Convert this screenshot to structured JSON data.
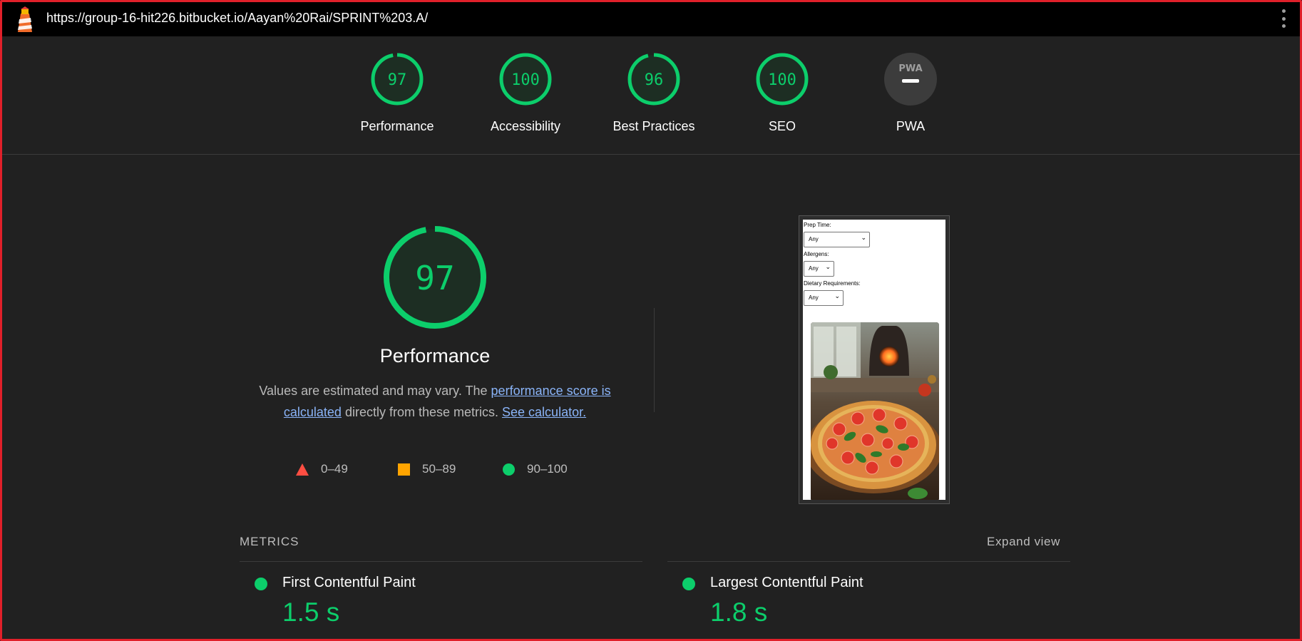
{
  "browser": {
    "url": "https://group-16-hit226.bitbucket.io/Aayan%20Rai/SPRINT%203.A/",
    "menu_icon": "kebab-menu-icon",
    "logo_icon": "lighthouse-icon"
  },
  "gauges": [
    {
      "score": "97",
      "label": "Performance",
      "color": "#0cce6b"
    },
    {
      "score": "100",
      "label": "Accessibility",
      "color": "#0cce6b"
    },
    {
      "score": "96",
      "label": "Best Practices",
      "color": "#0cce6b"
    },
    {
      "score": "100",
      "label": "SEO",
      "color": "#0cce6b"
    },
    {
      "score": "PWA",
      "label": "PWA",
      "color": "#9e9e9e"
    }
  ],
  "performance": {
    "score": "97",
    "title": "Performance",
    "desc_prefix": "Values are estimated and may vary. The ",
    "link1": "performance score is calculated",
    "desc_middle": " directly from these metrics. ",
    "link2": "See calculator.",
    "legend": [
      {
        "range": "0–49",
        "color": "#ff4e42"
      },
      {
        "range": "50–89",
        "color": "#ffa400"
      },
      {
        "range": "90–100",
        "color": "#0cce6b"
      }
    ]
  },
  "preview": {
    "fields": [
      {
        "label": "Prep Time:",
        "value": "Any"
      },
      {
        "label": "Allergens:",
        "value": "Any"
      },
      {
        "label": "Dietary Requirements:",
        "value": "Any"
      }
    ]
  },
  "metrics": {
    "title": "METRICS",
    "expand_label": "Expand view",
    "items": [
      {
        "name": "First Contentful Paint",
        "value": "1.5 s"
      },
      {
        "name": "Largest Contentful Paint",
        "value": "1.8 s"
      }
    ]
  }
}
